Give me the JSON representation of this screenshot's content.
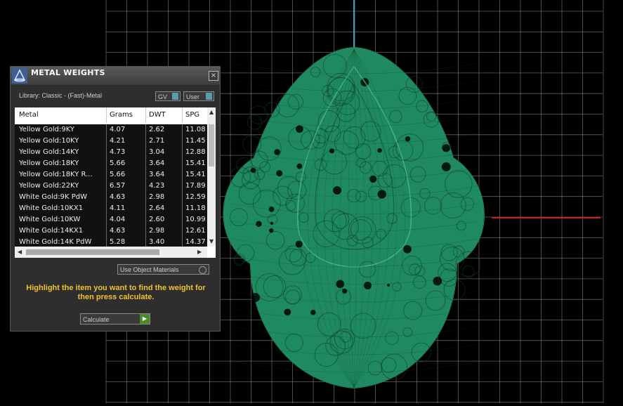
{
  "viewport": {
    "background": "#000000",
    "grid_color": "#8a8a8a",
    "axis_y_color": "#3aa0c0",
    "axis_x_color": "#c81e1e",
    "model_color": "#1f8a5f",
    "model_icon": "wireframe-egg-pendant"
  },
  "panel": {
    "title": "METAL WEIGHTS",
    "close_label": "×",
    "library_label": "Library: Classic - (Fast)-Metal",
    "gv_toggle": "GV",
    "user_toggle": "User",
    "columns": [
      "Metal",
      "Grams",
      "DWT",
      "SPG"
    ],
    "rows": [
      [
        "Yellow Gold:9KY",
        "4.07",
        "2.62",
        "11.08"
      ],
      [
        "Yellow Gold:10KY",
        "4.21",
        "2.71",
        "11.45"
      ],
      [
        "Yellow Gold:14KY",
        "4.73",
        "3.04",
        "12.88"
      ],
      [
        "Yellow Gold:18KY",
        "5.66",
        "3.64",
        "15.41"
      ],
      [
        "Yellow Gold:18KY R...",
        "5.66",
        "3.64",
        "15.41"
      ],
      [
        "Yellow Gold:22KY",
        "6.57",
        "4.23",
        "17.89"
      ],
      [
        "White Gold:9K PdW",
        "4.63",
        "2.98",
        "12.59"
      ],
      [
        "White Gold:10KX1",
        "4.11",
        "2.64",
        "11.18"
      ],
      [
        "White Gold:10KW",
        "4.04",
        "2.60",
        "10.99"
      ],
      [
        "White Gold:14KX1",
        "4.63",
        "2.98",
        "12.61"
      ],
      [
        "White Gold:14K PdW",
        "5.28",
        "3.40",
        "14.37"
      ]
    ],
    "use_object_materials": "Use Object Materials",
    "instruction": "Highlight the item you want to find the weight for then press calculate.",
    "calculate_label": "Calculate",
    "calculate_go": "▶"
  }
}
